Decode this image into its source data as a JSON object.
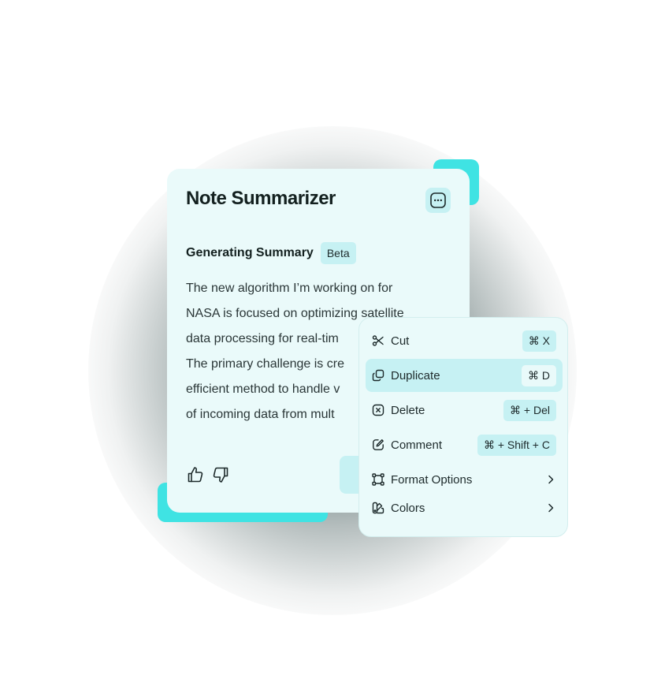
{
  "card": {
    "title": "Note Summarizer",
    "section_title": "Generating Summary",
    "badge": "Beta",
    "summary_lines": [
      "The new algorithm I’m working on for",
      "NASA is focused on optimizing satellite",
      "data processing for real-tim",
      "The primary challenge is cre",
      "efficient method to handle v",
      "of incoming data from mult"
    ],
    "icons": {
      "more": "more-icon",
      "like": "thumbs-up-icon",
      "dislike": "thumbs-down-icon"
    }
  },
  "menu": {
    "items": [
      {
        "label": "Cut",
        "shortcut": "⌘ X",
        "icon": "scissors-icon"
      },
      {
        "label": "Duplicate",
        "shortcut": "⌘ D",
        "icon": "duplicate-icon",
        "active": true
      },
      {
        "label": "Delete",
        "shortcut": "⌘ + Del",
        "icon": "delete-x-icon"
      },
      {
        "label": "Comment",
        "shortcut": "⌘ + Shift + C",
        "icon": "edit-icon"
      },
      {
        "label": "Format Options",
        "icon": "format-icon",
        "submenu": true
      },
      {
        "label": "Colors",
        "icon": "palette-icon",
        "submenu": true
      }
    ]
  },
  "colors": {
    "accent": "#3fe3e3",
    "card_bg": "#eafafa",
    "chip_bg": "#c6f1f3"
  }
}
